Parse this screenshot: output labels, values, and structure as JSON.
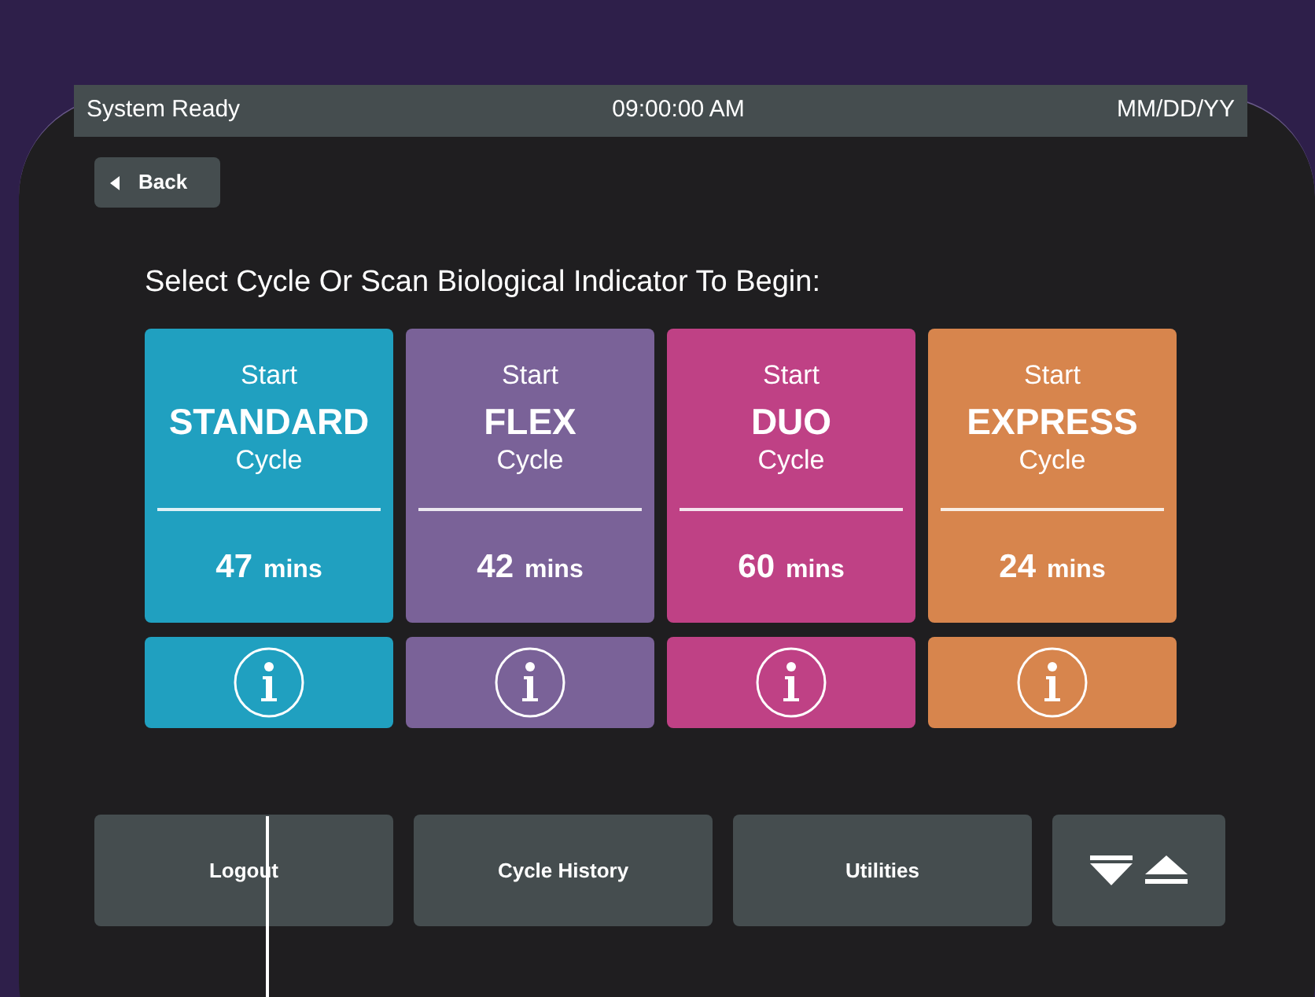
{
  "status_bar": {
    "status": "System Ready",
    "time": "09:00:00 AM",
    "date": "MM/DD/YY"
  },
  "back_button": {
    "label": "Back"
  },
  "prompt": "Select Cycle Or Scan Biological Indicator To Begin:",
  "cycles": [
    {
      "start": "Start",
      "name": "STANDARD",
      "suffix": "Cycle",
      "duration": "47",
      "unit": "mins",
      "color": "#20a0c0"
    },
    {
      "start": "Start",
      "name": "FLEX",
      "suffix": "Cycle",
      "duration": "42",
      "unit": "mins",
      "color": "#7a6298"
    },
    {
      "start": "Start",
      "name": "DUO",
      "suffix": "Cycle",
      "duration": "60",
      "unit": "mins",
      "color": "#bf4185"
    },
    {
      "start": "Start",
      "name": "EXPRESS",
      "suffix": "Cycle",
      "duration": "24",
      "unit": "mins",
      "color": "#d7854d"
    }
  ],
  "bottom_buttons": [
    {
      "kind": "text",
      "label": "Logout"
    },
    {
      "kind": "text",
      "label": "Cycle History"
    },
    {
      "kind": "text",
      "label": "Utilities"
    },
    {
      "kind": "icons"
    }
  ]
}
